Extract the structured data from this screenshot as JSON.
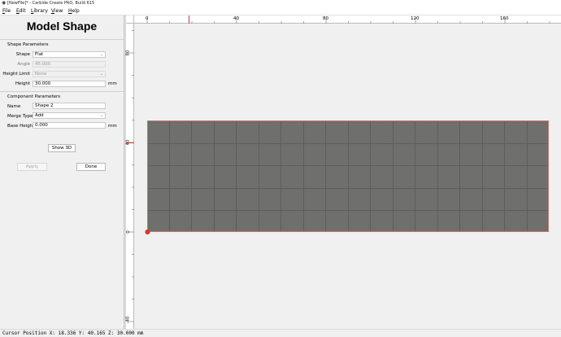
{
  "window": {
    "app_icon": "carbide-create-icon",
    "title": "[NewFile]* - Carbide Create PRO, Build 615"
  },
  "menu": {
    "items": [
      {
        "label": "File"
      },
      {
        "label": "Edit"
      },
      {
        "label": "Library"
      },
      {
        "label": "View"
      },
      {
        "label": "Help"
      }
    ]
  },
  "panel": {
    "title": "Model Shape",
    "shape_parameters": {
      "heading": "Shape Parameters",
      "shape_label": "Shape",
      "shape_value": "Flat",
      "angle_label": "Angle",
      "angle_value": "45.000",
      "height_limit_label": "Height Limit",
      "height_limit_value": "None",
      "height_label": "Height",
      "height_value": "30.000",
      "height_unit": "mm"
    },
    "component_parameters": {
      "heading": "Component Parameters",
      "name_label": "Name",
      "name_value": "Shape 2",
      "merge_type_label": "Merge Type",
      "merge_type_value": "Add",
      "base_height_label": "Base Height",
      "base_height_value": "0.000",
      "base_height_unit": "mm"
    },
    "buttons": {
      "show_3d": "Show 3D",
      "apply": "Apply",
      "done": "Done"
    }
  },
  "rulers": {
    "top_labels": [
      "0",
      "40",
      "80",
      "120",
      "160"
    ],
    "left_labels": [
      "80",
      "40",
      "0",
      "-40"
    ]
  },
  "colors": {
    "shape_fill": "#6f6f6d",
    "shape_outline": "#c5766a",
    "cursor_marker": "#d23a2e"
  },
  "status": {
    "text": "Cursor Position X: 18.336 Y: 40.165 Z: 30.000 mm"
  }
}
